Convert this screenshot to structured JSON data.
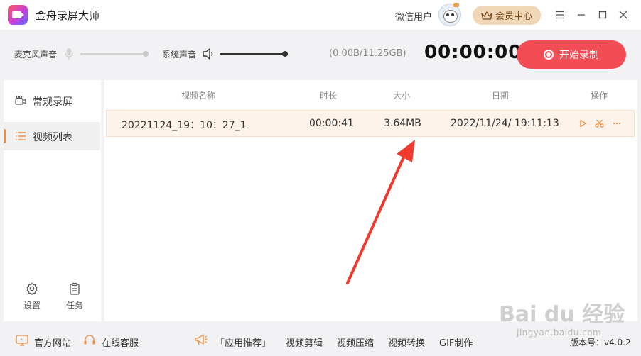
{
  "app": {
    "title": "金舟录屏大师"
  },
  "user": {
    "name": "微信用户",
    "vip_label": "会员中心"
  },
  "controls": {
    "mic_label": "麦克风声音",
    "mic_level": 0.0,
    "system_label": "系统声音",
    "system_level": 1.0,
    "storage": "(0.00B/11.25GB)",
    "timer": "00:00:00",
    "record_label": "开始录制"
  },
  "sidebar": {
    "items": [
      {
        "label": "常规录屏",
        "icon": "camera-icon",
        "active": false
      },
      {
        "label": "视频列表",
        "icon": "list-icon",
        "active": true
      }
    ],
    "settings_label": "设置",
    "tasks_label": "任务"
  },
  "table": {
    "headers": {
      "name": "视频名称",
      "duration": "时长",
      "size": "大小",
      "date": "日期",
      "actions": "操作"
    },
    "rows": [
      {
        "name": "20221124_19：10：27_1",
        "duration": "00:00:41",
        "size": "3.64MB",
        "date": "2022/11/24/ 19:11:13"
      }
    ]
  },
  "footer": {
    "website": "官方网站",
    "support": "在线客服",
    "recommend": "「应用推荐」",
    "links": [
      "视频剪辑",
      "视频压缩",
      "视频转换",
      "GIF制作"
    ],
    "version": "版本号：v4.0.2"
  },
  "watermark": {
    "brand": "Bai du 经验",
    "url": "jingyan.baidu.com"
  },
  "colors": {
    "accent": "#f24d55",
    "vip": "#f0d7b8",
    "row_highlight": "#fdf3ea",
    "active_marker": "#f08a3c"
  }
}
